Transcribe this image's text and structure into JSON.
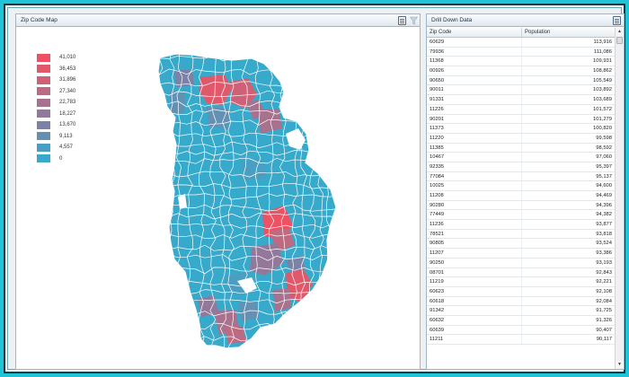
{
  "map_panel": {
    "title": "Zip Code Map",
    "export_icon": "document-icon",
    "filter_icon": "funnel-icon"
  },
  "legend": [
    {
      "label": "41,010",
      "color": "#ee5064"
    },
    {
      "label": "36,453",
      "color": "#e0596b"
    },
    {
      "label": "31,896",
      "color": "#cf6177"
    },
    {
      "label": "27,340",
      "color": "#bd6a82"
    },
    {
      "label": "22,783",
      "color": "#a8728e"
    },
    {
      "label": "18,227",
      "color": "#92799a"
    },
    {
      "label": "13,670",
      "color": "#7c82a6"
    },
    {
      "label": "9,113",
      "color": "#6490b4"
    },
    {
      "label": "4,557",
      "color": "#4a9ec2"
    },
    {
      "label": "0",
      "color": "#37a9cb"
    }
  ],
  "table_panel": {
    "title": "Drill Down Data",
    "export_icon": "document-icon",
    "headers": {
      "zip": "Zip Code",
      "population": "Population"
    },
    "rows": [
      {
        "zip": "60629",
        "population": "113,916"
      },
      {
        "zip": "79936",
        "population": "111,086"
      },
      {
        "zip": "11368",
        "population": "109,931"
      },
      {
        "zip": "00926",
        "population": "108,862"
      },
      {
        "zip": "90650",
        "population": "105,549"
      },
      {
        "zip": "90011",
        "population": "103,892"
      },
      {
        "zip": "91331",
        "population": "103,689"
      },
      {
        "zip": "11226",
        "population": "101,572"
      },
      {
        "zip": "90201",
        "population": "101,279"
      },
      {
        "zip": "11373",
        "population": "100,820"
      },
      {
        "zip": "11220",
        "population": "99,598"
      },
      {
        "zip": "11385",
        "population": "98,592"
      },
      {
        "zip": "10467",
        "population": "97,060"
      },
      {
        "zip": "92335",
        "population": "95,397"
      },
      {
        "zip": "77084",
        "population": "95,137"
      },
      {
        "zip": "10025",
        "population": "94,600"
      },
      {
        "zip": "11208",
        "population": "94,469"
      },
      {
        "zip": "90280",
        "population": "94,396"
      },
      {
        "zip": "77449",
        "population": "94,382"
      },
      {
        "zip": "11236",
        "population": "93,877"
      },
      {
        "zip": "78521",
        "population": "93,818"
      },
      {
        "zip": "90805",
        "population": "93,524"
      },
      {
        "zip": "11207",
        "population": "93,386"
      },
      {
        "zip": "90250",
        "population": "93,193"
      },
      {
        "zip": "08701",
        "population": "92,843"
      },
      {
        "zip": "11219",
        "population": "92,221"
      },
      {
        "zip": "60623",
        "population": "92,108"
      },
      {
        "zip": "60618",
        "population": "92,084"
      },
      {
        "zip": "91342",
        "population": "91,725"
      },
      {
        "zip": "60632",
        "population": "91,326"
      },
      {
        "zip": "60639",
        "population": "90,407"
      },
      {
        "zip": "11211",
        "population": "90,117"
      }
    ]
  }
}
